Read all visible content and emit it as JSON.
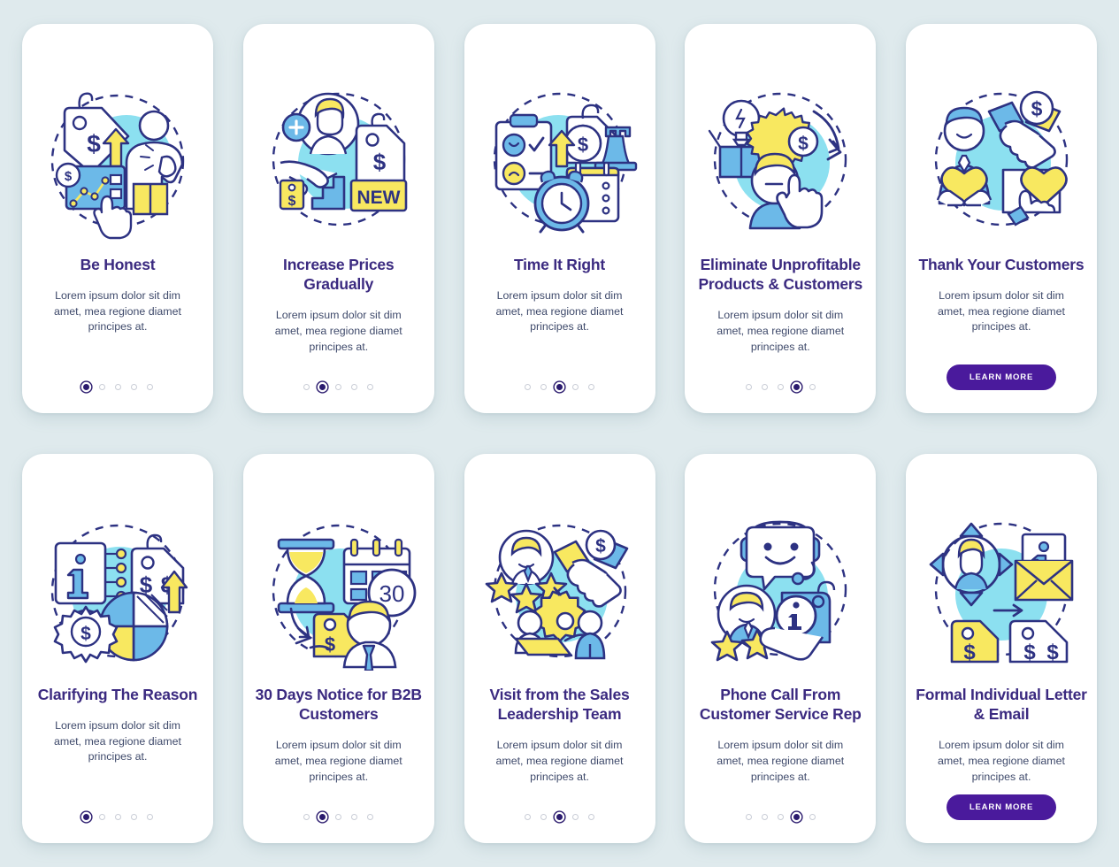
{
  "theme": {
    "page_background": "#dfeaed",
    "card_background": "#ffffff",
    "title_color": "#3b2a80",
    "body_color": "#3f4a6b",
    "accent_purple": "#4a1a9c",
    "dot_active": "#2b1b6e",
    "dot_inactive": "#c9cdd6",
    "illustration_outline": "#2d3282",
    "illustration_cyan": "#8ce0f0",
    "illustration_blue": "#6cb9e8",
    "illustration_yellow": "#f8e860"
  },
  "shared": {
    "body_text": "Lorem ipsum dolor sit dim amet, mea regione diamet principes at.",
    "learn_more_label": "LEARN MORE",
    "total_dots": 5
  },
  "rows": [
    {
      "cards": [
        {
          "title": "Be Honest",
          "body": "Lorem ipsum dolor sit dim amet, mea regione diamet principes at.",
          "footer_type": "dots",
          "active_dot": 1,
          "illustration": "price-tag-dollar-arrow-person-pointing"
        },
        {
          "title": "Increase Prices Gradually",
          "body": "Lorem ipsum dolor sit dim amet, mea regione diamet principes at.",
          "footer_type": "dots",
          "active_dot": 2,
          "illustration": "add-user-hand-stairs-new-tag"
        },
        {
          "title": "Time It Right",
          "body": "Lorem ipsum dolor sit dim amet, mea regione diamet principes at.",
          "footer_type": "dots",
          "active_dot": 3,
          "illustration": "clipboard-dollar-rook-alarm-clock-calendar"
        },
        {
          "title": "Eliminate Unprofitable Products & Customers",
          "body": "Lorem ipsum dolor sit dim amet, mea regione diamet principes at.",
          "footer_type": "dots",
          "active_dot": 4,
          "illustration": "lightbulb-gear-dollar-person-stop-hand"
        },
        {
          "title": "Thank Your Customers",
          "body": "Lorem ipsum dolor sit dim amet, mea regione diamet principes at.",
          "footer_type": "button",
          "button_label": "LEARN MORE",
          "illustration": "handshake-dollar-heart-thanks"
        }
      ]
    },
    {
      "cards": [
        {
          "title": "Clarifying The Reason",
          "body": "Lorem ipsum dolor sit dim amet, mea regione diamet principes at.",
          "footer_type": "dots",
          "active_dot": 1,
          "illustration": "info-card-price-tag-pie-chart-gear"
        },
        {
          "title": "30 Days Notice for B2B Customers",
          "body": "Lorem ipsum dolor sit dim amet, mea regione diamet principes at.",
          "footer_type": "dots",
          "active_dot": 2,
          "illustration": "hourglass-calendar-30-price-tag-person",
          "illustration_badge": "30"
        },
        {
          "title": "Visit from the Sales Leadership Team",
          "body": "Lorem ipsum dolor sit dim amet, mea regione diamet principes at.",
          "footer_type": "dots",
          "active_dot": 3,
          "illustration": "stars-handshake-gear-meeting"
        },
        {
          "title": "Phone Call From Customer Service Rep",
          "body": "Lorem ipsum dolor sit dim amet, mea regione diamet principes at.",
          "footer_type": "dots",
          "active_dot": 4,
          "illustration": "headset-smiley-stars-info-tag-hand"
        },
        {
          "title": "Formal Individual Letter & Email",
          "body": "Lorem ipsum dolor sit dim amet, mea regione diamet principes at.",
          "footer_type": "button",
          "button_label": "LEARN MORE",
          "illustration": "user-arrows-info-envelope-price-tags"
        }
      ]
    }
  ]
}
